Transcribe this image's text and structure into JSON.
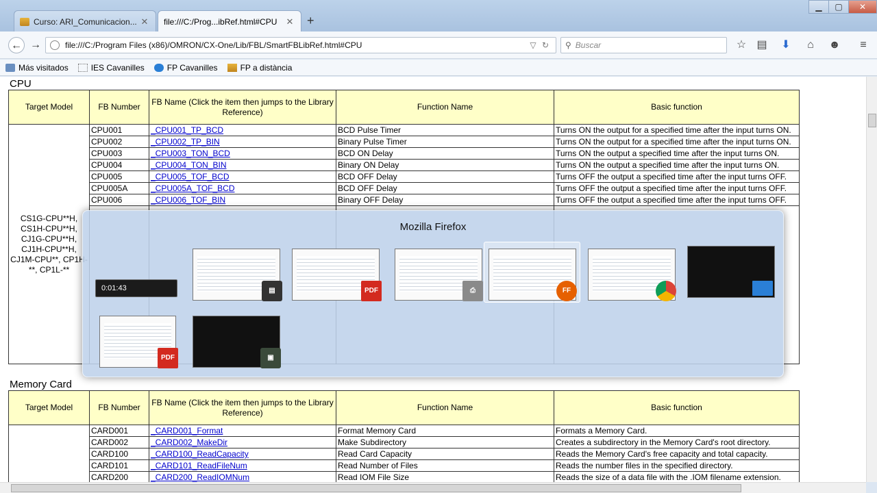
{
  "window": {
    "tabs": [
      {
        "label": "Curso: ARI_Comunicacion..."
      },
      {
        "label": "file:///C:/Prog...ibRef.html#CPU"
      }
    ],
    "new_tab": "+",
    "minimize": "▁",
    "maximize": "▢",
    "close": "✕"
  },
  "nav": {
    "url": "file:///C:/Program Files (x86)/OMRON/CX-One/Lib/FBL/SmartFBLibRef.html#CPU",
    "search_placeholder": "Buscar"
  },
  "bookmarks": [
    {
      "label": "Más visitados"
    },
    {
      "label": "IES Cavanilles"
    },
    {
      "label": "FP Cavanilles"
    },
    {
      "label": "FP a distància"
    }
  ],
  "cpu_section": {
    "title": "CPU",
    "headers": {
      "target_model": "Target Model",
      "fb_number": "FB Number",
      "fb_name": "FB Name (Click the item then jumps to the Library Reference)",
      "function_name": "Function Name",
      "basic_function": "Basic function"
    },
    "target_model": "CS1G-CPU**H, CS1H-CPU**H, CJ1G-CPU**H, CJ1H-CPU**H, CJ1M-CPU**, CP1H-**, CP1L-**",
    "rows": [
      {
        "num": "CPU001",
        "name": "_CPU001_TP_BCD",
        "func": "BCD Pulse Timer",
        "basic": "Turns ON the output for a specified time after the input turns ON."
      },
      {
        "num": "CPU002",
        "name": "_CPU002_TP_BIN",
        "func": "Binary Pulse Timer",
        "basic": "Turns ON the output for a specified time after the input turns ON."
      },
      {
        "num": "CPU003",
        "name": "_CPU003_TON_BCD",
        "func": "BCD ON Delay",
        "basic": "Turns ON the output a specified time after the input turns ON."
      },
      {
        "num": "CPU004",
        "name": "_CPU004_TON_BIN",
        "func": "Binary ON Delay",
        "basic": "Turns ON the output a specified time after the input turns ON."
      },
      {
        "num": "CPU005",
        "name": "_CPU005_TOF_BCD",
        "func": "BCD OFF Delay",
        "basic": "Turns OFF the output a specified time after the input turns OFF."
      },
      {
        "num": "CPU005A",
        "name": "_CPU005A_TOF_BCD",
        "func": "BCD OFF Delay",
        "basic": "Turns OFF the output a specified time after the input turns OFF."
      },
      {
        "num": "CPU006",
        "name": "_CPU006_TOF_BIN",
        "func": "Binary OFF Delay",
        "basic": "Turns OFF the output a specified time after the input turns OFF."
      }
    ]
  },
  "memory_section": {
    "title": "Memory Card",
    "headers": {
      "target_model": "Target Model",
      "fb_number": "FB Number",
      "fb_name": "FB Name (Click the item then jumps to the Library Reference)",
      "function_name": "Function Name",
      "basic_function": "Basic function"
    },
    "rows": [
      {
        "num": "CARD001",
        "name": "_CARD001_Format",
        "func": "Format Memory Card",
        "basic": "Formats a Memory Card."
      },
      {
        "num": "CARD002",
        "name": "_CARD002_MakeDir",
        "func": "Make Subdirectory",
        "basic": "Creates a subdirectory in the Memory Card's root directory."
      },
      {
        "num": "CARD100",
        "name": "_CARD100_ReadCapacity",
        "func": "Read Card Capacity",
        "basic": "Reads the Memory Card's free capacity and total capacity."
      },
      {
        "num": "CARD101",
        "name": "_CARD101_ReadFileNum",
        "func": "Read Number of Files",
        "basic": "Reads the number files in the specified directory."
      },
      {
        "num": "CARD200",
        "name": "_CARD200_ReadIOMNum",
        "func": "Read IOM File Size",
        "basic": "Reads the size of a data file with the .IOM filename extension."
      }
    ]
  },
  "switcher": {
    "title": "Mozilla Firefox",
    "timer": "0:01:43"
  }
}
